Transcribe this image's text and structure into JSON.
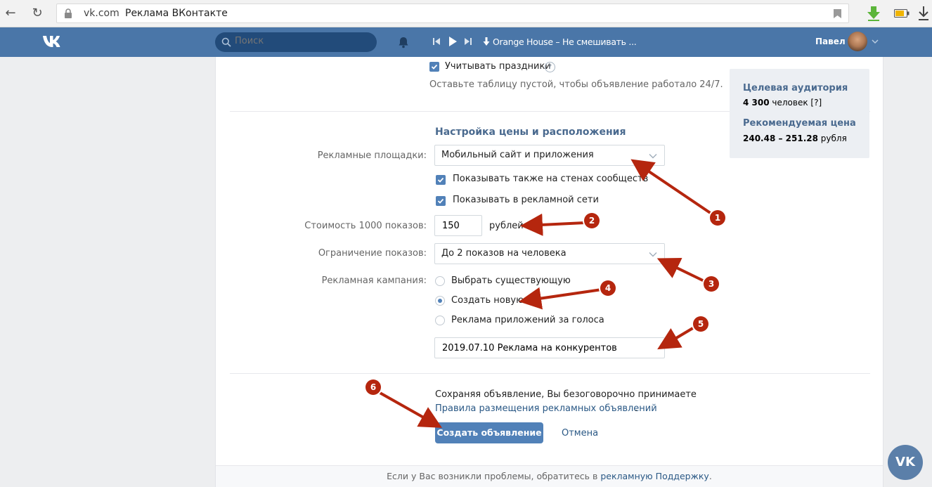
{
  "browser": {
    "domain": "vk.com",
    "page_title": "Реклама ВКонтакте"
  },
  "header": {
    "search_placeholder": "Поиск",
    "track_title": "Orange House – Не смешивать ...",
    "user_name": "Павел"
  },
  "form": {
    "holidays_label": "Учитывать праздники",
    "help_glyph": "?",
    "empty_table_hint": "Оставьте таблицу пустой, чтобы объявление работало 24/7.",
    "section_title": "Настройка цены и расположения",
    "placements_label": "Рекламные площадки:",
    "placements_value": "Мобильный сайт и приложения",
    "show_on_walls_label": "Показывать также на стенах сообществ",
    "show_in_network_label": "Показывать в рекламной сети",
    "cost_label": "Стоимость 1000 показов:",
    "cost_value": "150",
    "cost_unit": "рублей",
    "limit_label": "Ограничение показов:",
    "limit_value": "До 2 показов на человека",
    "campaign_label": "Рекламная кампания:",
    "campaign_options": [
      "Выбрать существующую",
      "Создать новую",
      "Реклама приложений за голоса"
    ],
    "campaign_name_value": "2019.07.10 Реклама на конкурентов",
    "agreement_text": "Сохраняя объявление, Вы безоговорочно принимаете",
    "agreement_link": "Правила размещения рекламных объявлений",
    "agreement_period": ".",
    "create_button": "Создать объявление",
    "cancel_button": "Отмена"
  },
  "side_panel": {
    "audience_title": "Целевая аудитория",
    "audience_count": "4 300",
    "audience_unit": "человек [?]",
    "price_title": "Рекомендуемая цена",
    "price_range": "240.48 – 251.28",
    "price_unit": "рубля"
  },
  "footer": {
    "text": "Если у Вас возникли проблемы, обратитесь в",
    "link": "рекламную Поддержку",
    "period": "."
  },
  "annotations": [
    "1",
    "2",
    "3",
    "4",
    "5",
    "6"
  ],
  "vk_logo": "VK",
  "colors": {
    "vk_blue": "#4a76a8",
    "accent": "#5181b8",
    "annotation_red": "#b5260e"
  }
}
